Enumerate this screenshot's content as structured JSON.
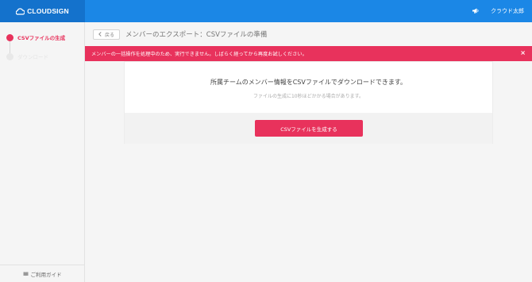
{
  "header": {
    "logo_text": "CLOUDSIGN",
    "user_name": "クラウド太郎",
    "notification_icon": "megaphone-icon"
  },
  "sidebar": {
    "steps": [
      {
        "label": "CSVファイルの生成",
        "state": "active"
      },
      {
        "label": "ダウンロード",
        "state": "inactive"
      }
    ],
    "guide_label": "ご利用ガイド"
  },
  "page": {
    "back_label": "戻る",
    "title": "メンバーのエクスポート：CSVファイルの準備"
  },
  "alert": {
    "message": "メンバーの一括操作を処理中のため、実行できません。しばらく経ってから再度お試しください。",
    "close_label": "×"
  },
  "card": {
    "message": "所属チームのメンバー情報をCSVファイルでダウンロードできます。",
    "sub_message": "ファイルの生成に10秒ほどかかる場合があります。",
    "button_label": "CSVファイルを生成する"
  },
  "colors": {
    "brand_blue": "#1b87e6",
    "brand_blue_dark": "#1472cc",
    "accent_pink": "#e8325c"
  }
}
